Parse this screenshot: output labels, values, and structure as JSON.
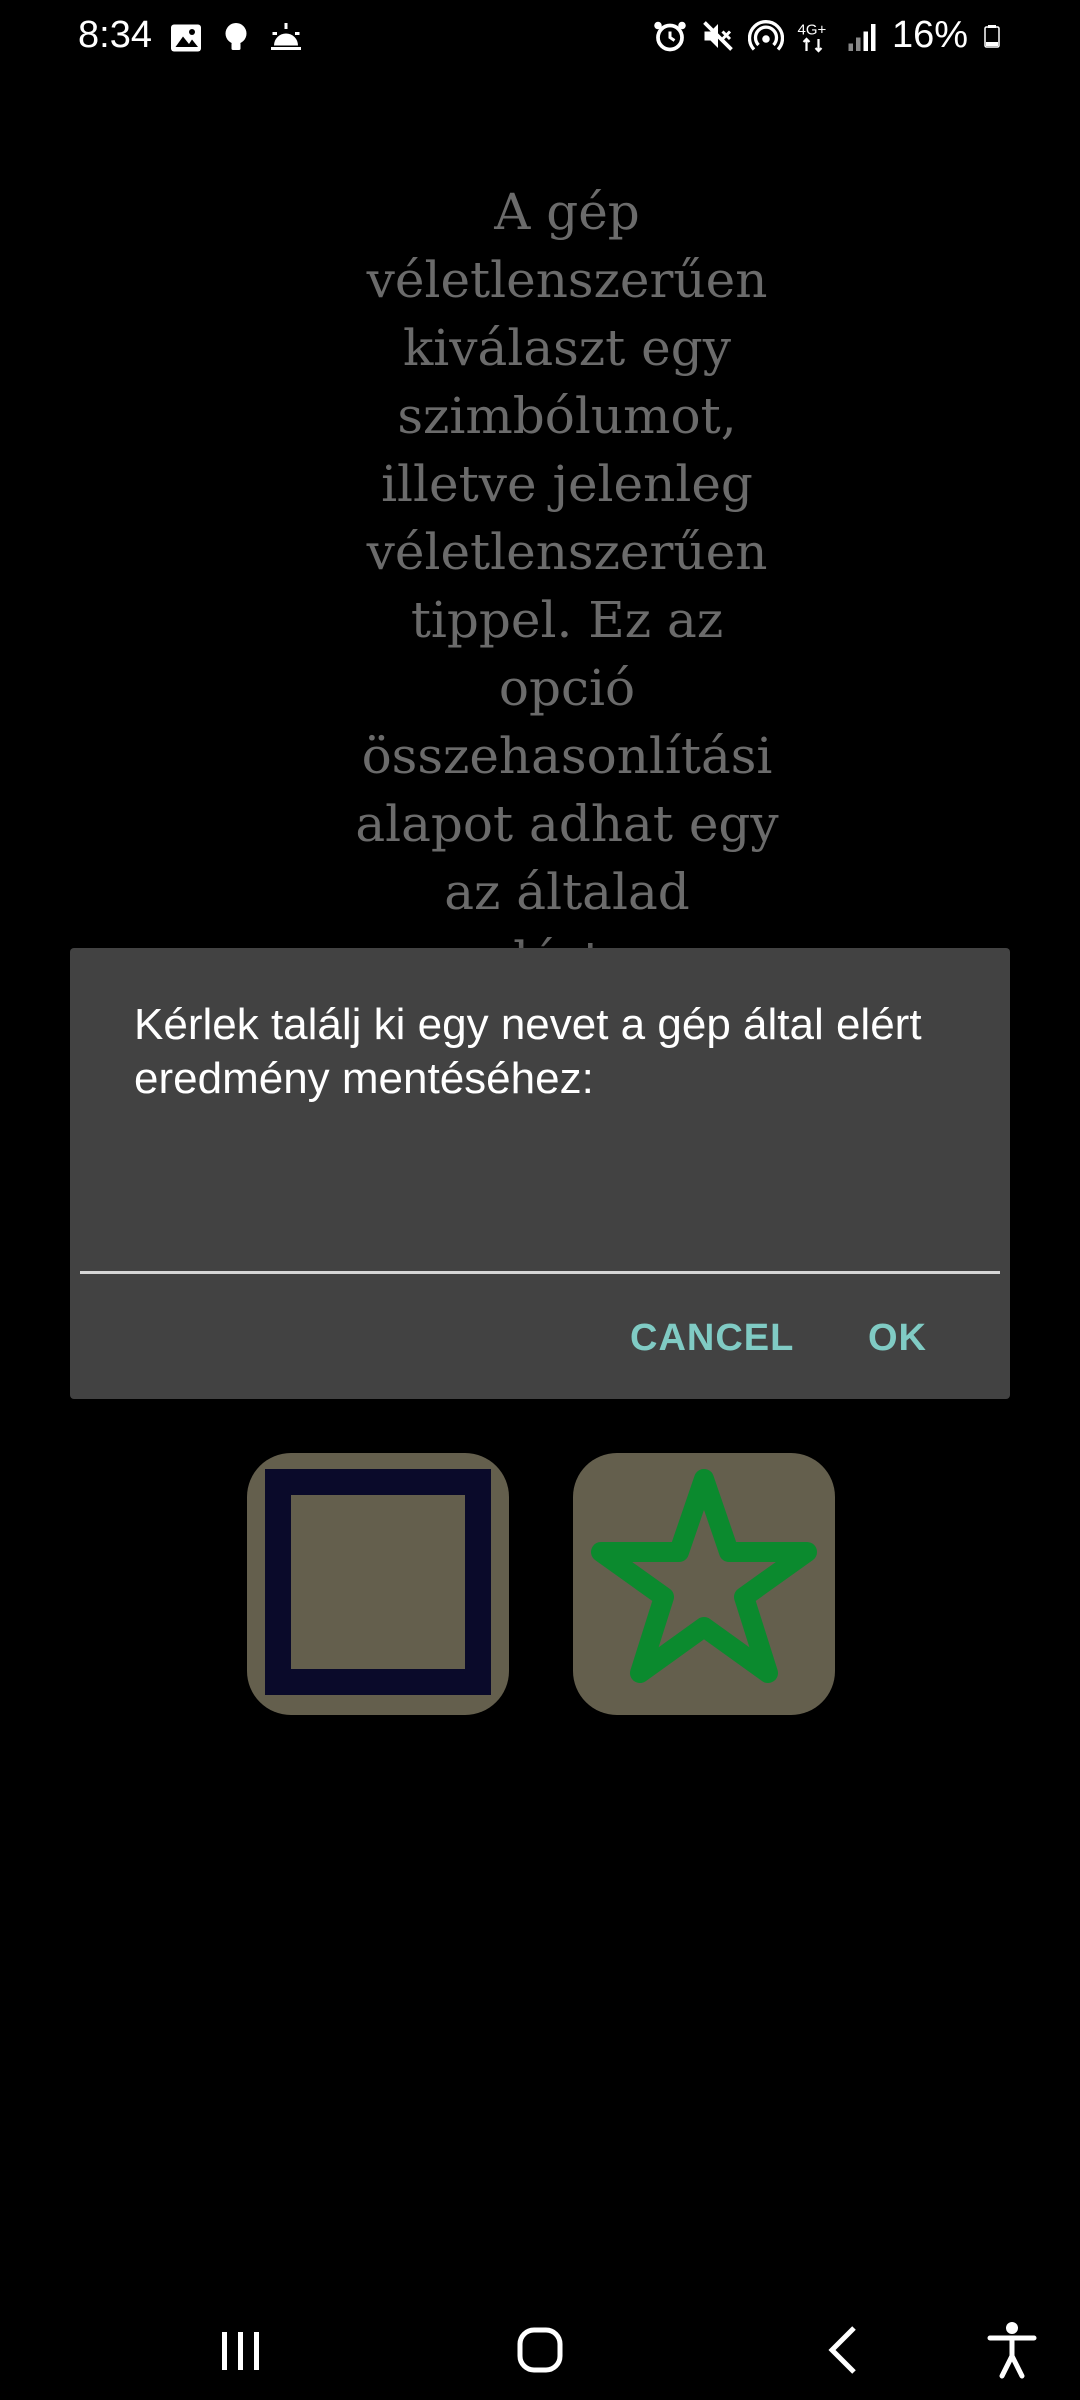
{
  "status_bar": {
    "time": "8:34",
    "battery_text": "16%",
    "left_icons": [
      "image-icon",
      "bulb-icon",
      "sunrise-icon"
    ],
    "right_icons": [
      "alarm-icon",
      "mute-icon",
      "hotspot-icon",
      "network-4g-icon",
      "signal-icon",
      "battery-icon"
    ],
    "network_label": "4G+"
  },
  "background": {
    "description_lines": [
      "A gép",
      "véletlenszerűen",
      "kiválaszt egy",
      "szimbólumot,",
      "illetve jelenleg",
      "véletlenszerűen",
      "tippel. Ez az",
      "opció",
      "összehasonlítási",
      "alapot adhat egy",
      "az általad",
      "elért..."
    ],
    "symbols": [
      "square-symbol",
      "star-symbol"
    ],
    "colors": {
      "square_stroke": "#0a0a2a",
      "star_stroke": "#0b8a2e",
      "tile_bg": "#645f4d"
    }
  },
  "dialog": {
    "message": "Kérlek találj ki egy nevet a gép által elért eredmény mentéséhez:",
    "input_value": "",
    "input_placeholder": "",
    "cancel_label": "CANCEL",
    "ok_label": "OK",
    "accent": "#80cbc4",
    "background": "#424242"
  },
  "nav_bar": {
    "items": [
      "recent-apps-icon",
      "home-icon",
      "back-icon",
      "accessibility-icon"
    ]
  }
}
